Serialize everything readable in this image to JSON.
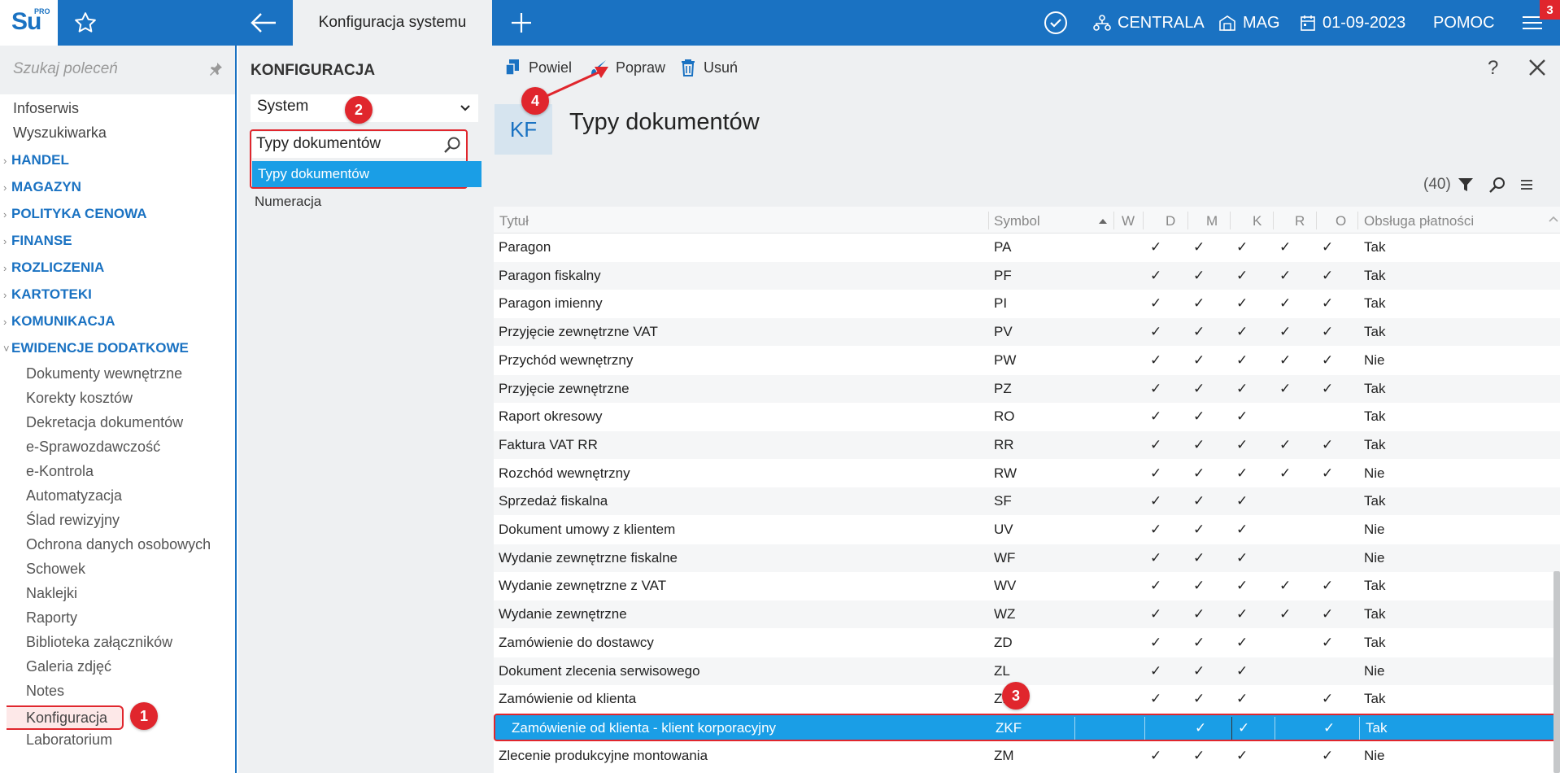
{
  "topbar": {
    "logo_text": "Su",
    "logo_super": "PRO",
    "active_tab": "Konfiguracja systemu",
    "centrala": "CENTRALA",
    "mag": "MAG",
    "date": "01-09-2023",
    "help": "POMOC",
    "notifications": "3"
  },
  "sidebar": {
    "search_placeholder": "Szukaj poleceń",
    "top_items": [
      "Infoserwis",
      "Wyszukiwarka"
    ],
    "sections": [
      "HANDEL",
      "MAGAZYN",
      "POLITYKA CENOWA",
      "FINANSE",
      "ROZLICZENIA",
      "KARTOTEKI",
      "KOMUNIKACJA",
      "EWIDENCJE DODATKOWE"
    ],
    "sub_items": [
      "Dokumenty wewnętrzne",
      "Korekty kosztów",
      "Dekretacja dokumentów",
      "e-Sprawozdawczość",
      "e-Kontrola",
      "Automatyzacja",
      "Ślad rewizyjny",
      "Ochrona danych osobowych",
      "Schowek",
      "Naklejki",
      "Raporty",
      "Biblioteka załączników",
      "Galeria zdjęć",
      "Notes",
      "Konfiguracja",
      "Laboratorium"
    ]
  },
  "config": {
    "title": "KONFIGURACJA",
    "select_value": "System",
    "search_value": "Typy dokumentów",
    "selected_item": "Typy dokumentów",
    "other_item": "Numeracja"
  },
  "main": {
    "toolbar": {
      "duplicate": "Powiel",
      "edit": "Popraw",
      "delete": "Usuń",
      "help": "?"
    },
    "badge": "KF",
    "title": "Typy dokumentów",
    "count": "(40)",
    "columns": [
      "Tytuł",
      "Symbol",
      "W",
      "D",
      "M",
      "K",
      "R",
      "O",
      "Obsługa płatności"
    ],
    "check": "✓",
    "rows": [
      {
        "title": "Paragon",
        "symbol": "PA",
        "flags": [
          1,
          1,
          1,
          1,
          1,
          0
        ],
        "pay": "Tak"
      },
      {
        "title": "Paragon fiskalny",
        "symbol": "PF",
        "flags": [
          1,
          1,
          1,
          1,
          1,
          0
        ],
        "pay": "Tak"
      },
      {
        "title": "Paragon imienny",
        "symbol": "PI",
        "flags": [
          1,
          1,
          1,
          1,
          1,
          0
        ],
        "pay": "Tak"
      },
      {
        "title": "Przyjęcie zewnętrzne VAT",
        "symbol": "PV",
        "flags": [
          1,
          1,
          1,
          1,
          1,
          0
        ],
        "pay": "Tak"
      },
      {
        "title": "Przychód wewnętrzny",
        "symbol": "PW",
        "flags": [
          1,
          1,
          1,
          1,
          1,
          0
        ],
        "pay": "Nie"
      },
      {
        "title": "Przyjęcie zewnętrzne",
        "symbol": "PZ",
        "flags": [
          1,
          1,
          1,
          1,
          1,
          0
        ],
        "pay": "Tak"
      },
      {
        "title": "Raport okresowy",
        "symbol": "RO",
        "flags": [
          1,
          1,
          1,
          0,
          0,
          0
        ],
        "pay": "Tak"
      },
      {
        "title": "Faktura VAT RR",
        "symbol": "RR",
        "flags": [
          1,
          1,
          1,
          1,
          1,
          0
        ],
        "pay": "Tak"
      },
      {
        "title": "Rozchód wewnętrzny",
        "symbol": "RW",
        "flags": [
          1,
          1,
          1,
          1,
          1,
          0
        ],
        "pay": "Nie"
      },
      {
        "title": "Sprzedaż fiskalna",
        "symbol": "SF",
        "flags": [
          1,
          1,
          1,
          0,
          0,
          0
        ],
        "pay": "Tak"
      },
      {
        "title": "Dokument umowy z klientem",
        "symbol": "UV",
        "flags": [
          1,
          1,
          1,
          0,
          0,
          0
        ],
        "pay": "Nie"
      },
      {
        "title": "Wydanie zewnętrzne fiskalne",
        "symbol": "WF",
        "flags": [
          1,
          1,
          1,
          0,
          0,
          0
        ],
        "pay": "Nie"
      },
      {
        "title": "Wydanie zewnętrzne z VAT",
        "symbol": "WV",
        "flags": [
          1,
          1,
          1,
          1,
          1,
          0
        ],
        "pay": "Tak"
      },
      {
        "title": "Wydanie zewnętrzne",
        "symbol": "WZ",
        "flags": [
          1,
          1,
          1,
          1,
          1,
          0
        ],
        "pay": "Tak"
      },
      {
        "title": "Zamówienie do dostawcy",
        "symbol": "ZD",
        "flags": [
          1,
          1,
          1,
          0,
          1,
          0
        ],
        "pay": "Tak"
      },
      {
        "title": "Dokument zlecenia serwisowego",
        "symbol": "ZL",
        "flags": [
          1,
          1,
          1,
          0,
          0,
          0
        ],
        "pay": "Nie"
      },
      {
        "title": "Zamówienie od klienta",
        "symbol": "ZK",
        "flags": [
          1,
          1,
          1,
          0,
          1,
          0
        ],
        "pay": "Tak"
      },
      {
        "title": "Zamówienie od klienta - klient korporacyjny",
        "symbol": "ZKF",
        "flags": [
          0,
          1,
          1,
          0,
          1,
          0
        ],
        "pay": "Tak",
        "selected": true
      },
      {
        "title": "Zlecenie produkcyjne montowania",
        "symbol": "ZM",
        "flags": [
          1,
          1,
          1,
          0,
          1,
          0
        ],
        "pay": "Nie"
      }
    ]
  },
  "annotations": [
    "1",
    "2",
    "3",
    "4"
  ],
  "colors": {
    "brand": "#1a72c2",
    "selection": "#1a9ee6",
    "annotation": "#e0262d"
  }
}
